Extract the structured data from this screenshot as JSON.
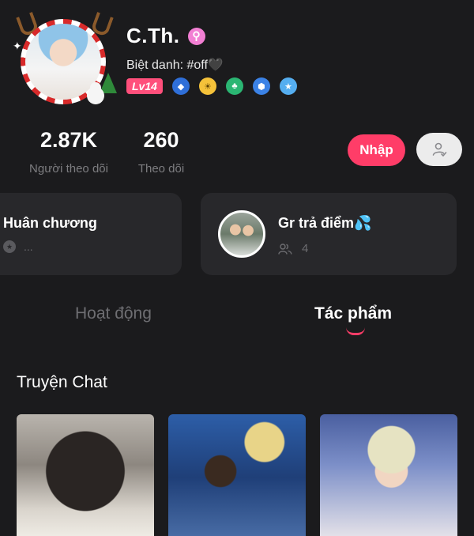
{
  "profile": {
    "name": "C.Th.",
    "gender_icon": "gender-symbol-icon",
    "nickname": "Biệt danh: #off🖤",
    "level": "Lv14",
    "badges": [
      "water-drop-badge",
      "sun-badge",
      "leaf-badge",
      "shield-badge",
      "star-badge"
    ]
  },
  "stats": {
    "followers_count": "2.87K",
    "followers_label": "Người theo dõi",
    "following_count": "260",
    "following_label": "Theo dõi"
  },
  "actions": {
    "join_label": "Nhập"
  },
  "medals": {
    "title": "Huân chương",
    "placeholder": "..."
  },
  "group": {
    "title": "Gr trả điểm💦",
    "member_count": "4"
  },
  "tabs": [
    {
      "label": "Hoạt động",
      "active": false
    },
    {
      "label": "Tác phẩm",
      "active": true
    }
  ],
  "section": {
    "title": "Truyện Chat"
  },
  "colors": {
    "accent": "#ff3d68",
    "background": "#1b1b1d",
    "card": "#28282b"
  }
}
